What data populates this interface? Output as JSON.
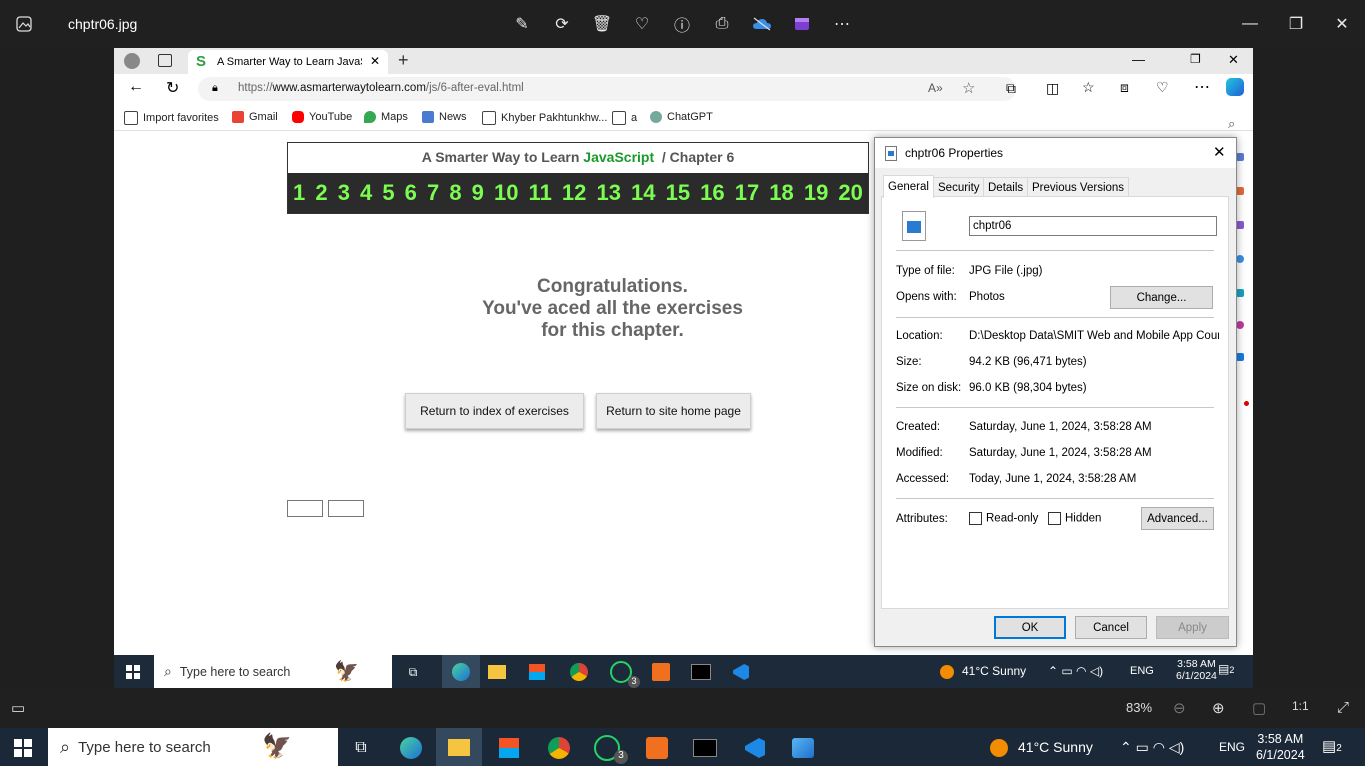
{
  "viewer": {
    "file_name": "chptr06.jpg",
    "zoom": "83%"
  },
  "browser": {
    "tab_title": "A Smarter Way to Learn JavaScrip",
    "url_prefix": "https://",
    "url_host": "www.asmarterwaytolearn.com",
    "url_path": "/js/6-after-eval.html",
    "favorites": [
      "Import favorites",
      "Gmail",
      "YouTube",
      "Maps",
      "News",
      "Khyber Pakhtunkhw...",
      "a",
      "ChatGPT"
    ]
  },
  "webpage": {
    "title_prefix": "A Smarter Way to Learn ",
    "title_js": "JavaScript",
    "title_suffix": "/ Chapter 6",
    "chapters": [
      "1",
      "2",
      "3",
      "4",
      "5",
      "6",
      "7",
      "8",
      "9",
      "10",
      "11",
      "12",
      "13",
      "14",
      "15",
      "16",
      "17",
      "18",
      "19",
      "20"
    ],
    "congrats_line1": "Congratulations.",
    "congrats_line2": "You've aced all the exercises",
    "congrats_line3": "for this chapter.",
    "btn_index": "Return to index of exercises",
    "btn_home": "Return to site home page"
  },
  "dialog": {
    "title": "chptr06 Properties",
    "tabs": [
      "General",
      "Security",
      "Details",
      "Previous Versions"
    ],
    "file_name_value": "chptr06",
    "type_label": "Type of file:",
    "type_value": "JPG File (.jpg)",
    "opens_label": "Opens with:",
    "opens_value": "Photos",
    "change_btn": "Change...",
    "location_label": "Location:",
    "location_value": "D:\\Desktop Data\\SMIT Web and Mobile App Cours",
    "size_label": "Size:",
    "size_value": "94.2 KB (96,471 bytes)",
    "disk_label": "Size on disk:",
    "disk_value": "96.0 KB (98,304 bytes)",
    "created_label": "Created:",
    "created_value": "Saturday, June 1, 2024, 3:58:28 AM",
    "modified_label": "Modified:",
    "modified_value": "Saturday, June 1, 2024, 3:58:28 AM",
    "accessed_label": "Accessed:",
    "accessed_value": "Today, June 1, 2024, 3:58:28 AM",
    "attributes_label": "Attributes:",
    "readonly_label": "Read-only",
    "hidden_label": "Hidden",
    "advanced_btn": "Advanced...",
    "ok_btn": "OK",
    "cancel_btn": "Cancel",
    "apply_btn": "Apply"
  },
  "inner_taskbar": {
    "search_placeholder": "Type here to search",
    "weather": "41°C  Sunny",
    "lang": "ENG",
    "time": "3:58 AM",
    "date": "6/1/2024",
    "whatsapp_badge": "3",
    "notif_badge": "2"
  },
  "taskbar": {
    "search_placeholder": "Type here to search",
    "weather": "41°C  Sunny",
    "lang": "ENG",
    "time": "3:58 AM",
    "date": "6/1/2024",
    "whatsapp_badge": "3",
    "notif_badge": "2"
  }
}
